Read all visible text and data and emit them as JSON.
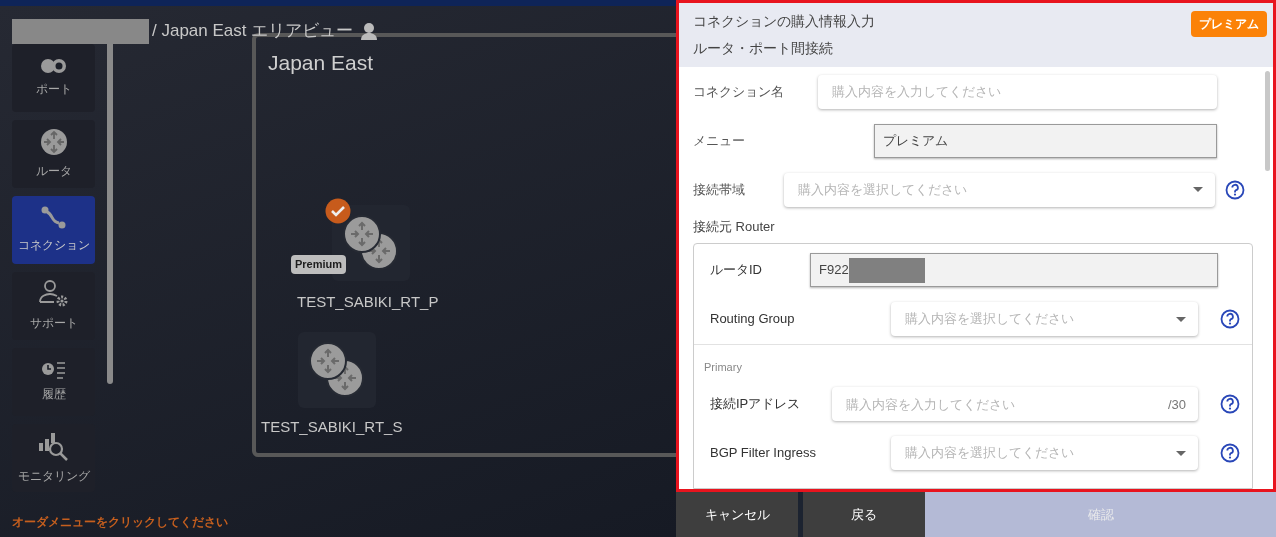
{
  "breadcrumb": {
    "text": "/ Japan East エリアビュー"
  },
  "sidebar": {
    "items": [
      {
        "label": "ポート",
        "selected": false
      },
      {
        "label": "ルータ",
        "selected": false
      },
      {
        "label": "コネクション",
        "selected": true
      },
      {
        "label": "サポート",
        "selected": false
      },
      {
        "label": "履歴",
        "selected": false
      },
      {
        "label": "モニタリング",
        "selected": false
      }
    ]
  },
  "canvas": {
    "region_title": "Japan East",
    "routers": [
      {
        "name": "TEST_SABIKI_RT_P",
        "checked": true,
        "badge": "Premium"
      },
      {
        "name": "TEST_SABIKI_RT_S",
        "checked": false
      }
    ]
  },
  "footer_hint": "オーダメニューをクリックしてください",
  "panel": {
    "title": "コネクションの購入情報入力",
    "subtitle": "ルータ・ポート間接続",
    "badge": "プレミアム",
    "fields": [
      {
        "label": "コネクション名",
        "kind": "input",
        "placeholder": "購入内容を入力してください",
        "help": false
      },
      {
        "label": "メニュー",
        "kind": "readonly",
        "value": "プレミアム",
        "help": false
      },
      {
        "label": "接続帯域",
        "kind": "select",
        "placeholder": "購入内容を選択してください",
        "help": true
      }
    ],
    "section_title": "接続元 Router",
    "router_fields": [
      {
        "label": "ルータID",
        "kind": "readonly",
        "value": "F922",
        "redacted": true,
        "help": false
      },
      {
        "label": "Routing Group",
        "kind": "select",
        "placeholder": "購入内容を選択してください",
        "help": true
      }
    ],
    "group_label": "Primary",
    "primary_fields": [
      {
        "label": "接続IPアドレス",
        "kind": "input",
        "placeholder": "購入内容を入力してください",
        "suffix": "/30",
        "help": true
      },
      {
        "label": "BGP Filter Ingress",
        "kind": "select",
        "placeholder": "購入内容を選択してください",
        "help": true
      }
    ]
  },
  "buttons": [
    {
      "label": "キャンセル",
      "kind": "cancel",
      "disabled": false
    },
    {
      "label": "戻る",
      "kind": "back",
      "disabled": false
    },
    {
      "label": "確認",
      "kind": "confirm",
      "disabled": true
    }
  ]
}
